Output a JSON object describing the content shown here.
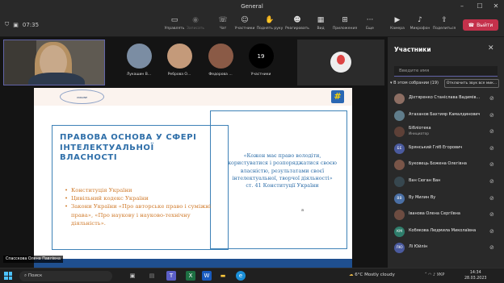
{
  "window": {
    "title": "General",
    "controls": [
      "minimize",
      "maximize",
      "close"
    ],
    "timer": "07:35"
  },
  "toolbar": {
    "buttons": [
      {
        "icon": "screen-icon",
        "label": "Управлять"
      },
      {
        "icon": "record-icon",
        "label": "Записать"
      },
      {
        "icon": "chat-icon",
        "label": "Чат"
      },
      {
        "icon": "people-icon",
        "label": "Участники"
      },
      {
        "icon": "hand-icon",
        "label": "Поднять руку"
      },
      {
        "icon": "reactions-icon",
        "label": "Реагировать"
      },
      {
        "icon": "view-icon",
        "label": "Вид"
      },
      {
        "icon": "apps-icon",
        "label": "Приложения"
      },
      {
        "icon": "more-icon",
        "label": "Еще"
      },
      {
        "icon": "camera-icon",
        "label": "Камера"
      },
      {
        "icon": "mic-icon",
        "label": "Микрофон"
      },
      {
        "icon": "share-icon",
        "label": "Поделиться"
      }
    ],
    "leave_label": "Выйти"
  },
  "video_tiles": [
    {
      "name": "Лукашин В...",
      "color": "#7b8da3"
    },
    {
      "name": "Реброва О...",
      "color": "#c49a7a"
    },
    {
      "name": "Федорова ...",
      "color": "#8a5a46"
    }
  ],
  "participants_count": {
    "value": "19",
    "label": "Участники"
  },
  "slide": {
    "logo_text": "UKRAINE",
    "heading": "ПРАВОВА ОСНОВА У СФЕРІ ІНТЕЛЕКТУАЛЬНОЇ ВЛАСНОСТІ",
    "bullets": [
      "Конституція України",
      "Цивільний кодекс України",
      "Закони України «Про авторське право і суміжні права», «Про наукову і науково-технічну діяльність»."
    ],
    "quote": "«Кожен має право володіти, користуватися і розпоряджатися своєю власністю, результатами своєї інтелектуальної, творчої діяльності» ст. 41 Конституції України",
    "dot": "a"
  },
  "presenter_name": "Спасскова Олена Павлівна",
  "panel": {
    "title": "Участники",
    "search_placeholder": "Введите имя",
    "section_label": "В этом собрании (19)",
    "mute_all": "Отключить звук все мик...",
    "participants": [
      {
        "name": "Діхтяренко Станіслава Вадимів...",
        "initials": "",
        "color": "#8d6e63",
        "sub": ""
      },
      {
        "name": "Атаханов Бахтияр Камалдинович",
        "initials": "",
        "color": "#607d8b",
        "sub": ""
      },
      {
        "name": "Бібліотека",
        "initials": "",
        "color": "#5d4037",
        "sub": "Инициатор"
      },
      {
        "name": "Брянський Гліб Егорович",
        "initials": "БЕ",
        "color": "#4a5a9e",
        "sub": ""
      },
      {
        "name": "Буковець Божена Олегівна",
        "initials": "",
        "color": "#795548",
        "sub": ""
      },
      {
        "name": "Ван Сюган Ван",
        "initials": "",
        "color": "#37474f",
        "sub": ""
      },
      {
        "name": "Ву Милин Ву",
        "initials": "ВВ",
        "color": "#4a6fa5",
        "sub": ""
      },
      {
        "name": "Іванова Олена Сергіївна",
        "initials": "",
        "color": "#6d4c41",
        "sub": ""
      },
      {
        "name": "Кобякова Людмила Миколаївна",
        "initials": "КМ",
        "color": "#2e7d6b",
        "sub": ""
      },
      {
        "name": "Лі Юйлін",
        "initials": "ЛЮ",
        "color": "#4a5a9e",
        "sub": ""
      }
    ]
  },
  "taskbar": {
    "search_label": "Поиск",
    "weather": "6°C  Mostly cloudy",
    "lang": "УКР",
    "time": "14:34",
    "date": "28.03.2023"
  }
}
